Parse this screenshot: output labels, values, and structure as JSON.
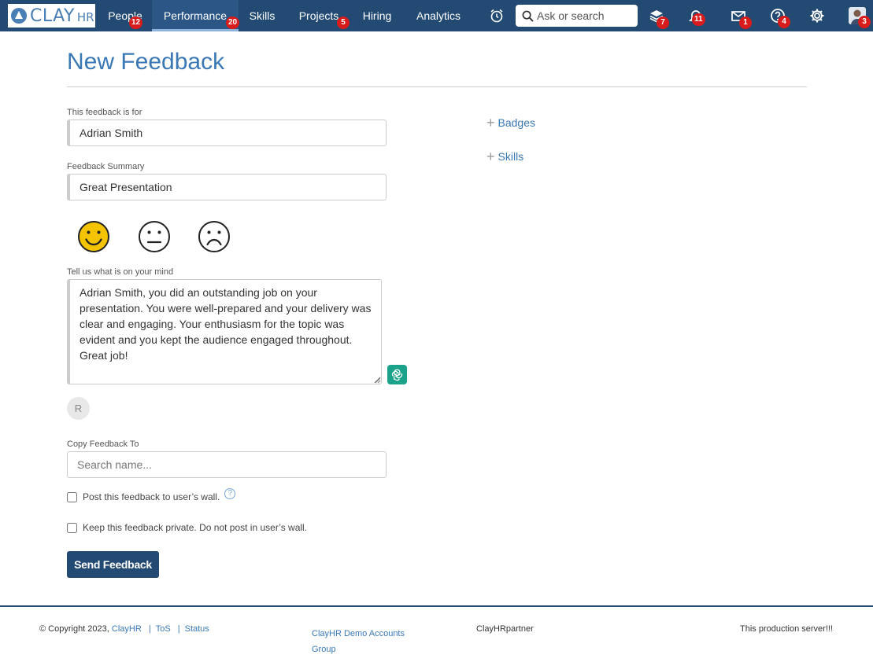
{
  "brand": {
    "logo_text": "CLAY",
    "logo_suffix": "HR"
  },
  "nav": {
    "items": [
      {
        "label": "People",
        "badge": "12"
      },
      {
        "label": "Performance",
        "badge": "20"
      },
      {
        "label": "Skills"
      },
      {
        "label": "Projects",
        "badge": "5"
      },
      {
        "label": "Hiring"
      },
      {
        "label": "Analytics"
      }
    ]
  },
  "search": {
    "placeholder": "Ask or search"
  },
  "top_icons": {
    "alarm": {
      "name": "alarm-clock-icon"
    },
    "stack": {
      "name": "layers-icon",
      "badge": "7"
    },
    "notifications": {
      "name": "bell-icon",
      "badge": "11"
    },
    "mail": {
      "name": "mail-icon",
      "badge": "1"
    },
    "help": {
      "name": "help-icon",
      "badge": "4"
    },
    "settings": {
      "name": "gear-icon"
    },
    "profile": {
      "name": "avatar",
      "badge": "3"
    }
  },
  "page": {
    "title": "New Feedback"
  },
  "form": {
    "recipient_label": "This feedback is for",
    "recipient_value": "Adrian Smith",
    "summary_label": "Feedback Summary",
    "summary_value": "Great Presentation",
    "mind_label": "Tell us what is on your mind",
    "mind_value": "Adrian Smith, you did an outstanding job on your presentation. You were well-prepared and your delivery was clear and engaging. Your enthusiasm for the topic was evident and you kept the audience engaged throughout. Great job!",
    "avatar_letter": "R",
    "copy_label": "Copy Feedback To",
    "copy_placeholder": "Search name...",
    "post_wall_label": "Post this feedback to user’s wall.",
    "private_label": "Keep this feedback private. Do not post in user’s wall.",
    "submit_label": "Send Feedback"
  },
  "sidebar": {
    "badges_label": "Badges",
    "skills_label": "Skills"
  },
  "footer": {
    "copyright": "© Copyright 2023,",
    "company_link": "ClayHR",
    "tos_link": "ToS",
    "status_link": "Status",
    "divider": "|",
    "demo_accounts": "ClayHR Demo Accounts Group",
    "partner": "ClayHRpartner",
    "server_note": "This production server!!!"
  },
  "colors": {
    "nav_bg": "#234a73",
    "accent": "#3a78b5",
    "badge": "#d81b1b",
    "happy_face": "#f5c400",
    "ai_button": "#1aa28a"
  }
}
